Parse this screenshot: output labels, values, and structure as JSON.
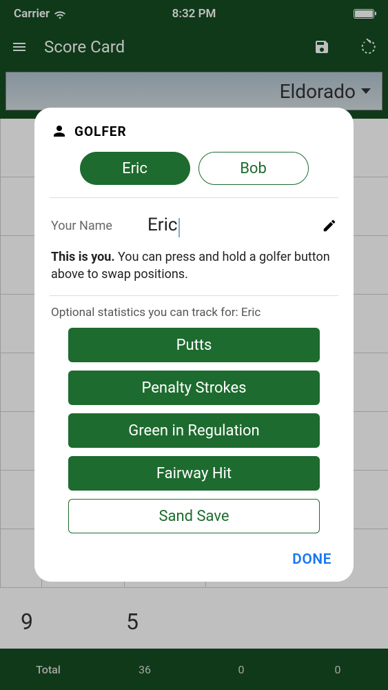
{
  "status": {
    "carrier": "Carrier",
    "time": "8:32 PM"
  },
  "appbar": {
    "title": "Score Card"
  },
  "course": {
    "name": "Eldorado"
  },
  "bg": {
    "n9": "9",
    "n5": "5"
  },
  "footer": {
    "label": "Total",
    "v1": "36",
    "v2": "0",
    "v3": "0"
  },
  "dialog": {
    "title": "GOLFER",
    "golfers": {
      "g1": "Eric",
      "g2": "Bob"
    },
    "name_label": "Your Name",
    "name_value": "Eric",
    "instruction_bold": "This is you.",
    "instruction_rest": " You can press and hold a golfer button above to swap positions.",
    "stats_label": "Optional statistics you can track for: Eric",
    "stats": {
      "s1": "Putts",
      "s2": "Penalty Strokes",
      "s3": "Green in Regulation",
      "s4": "Fairway Hit",
      "s5": "Sand Save"
    },
    "done": "DONE"
  }
}
